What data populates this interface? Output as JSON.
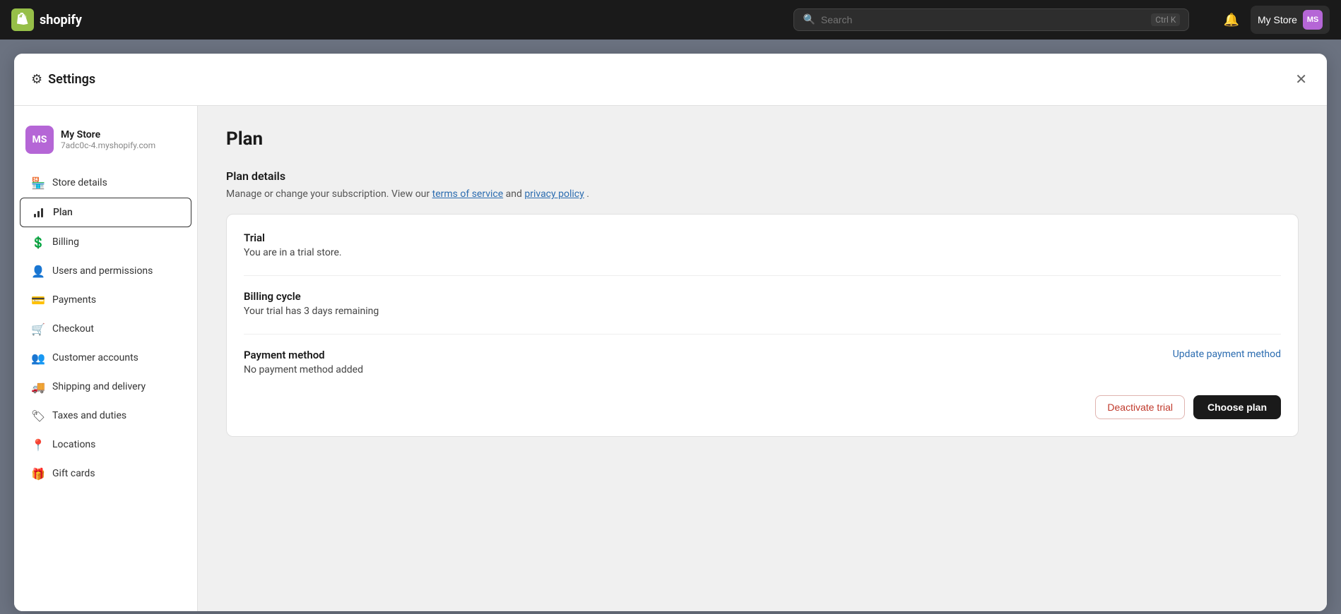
{
  "navbar": {
    "logo_text": "shopify",
    "logo_initials": "S",
    "search_placeholder": "Search",
    "search_shortcut": "Ctrl K",
    "store_name": "My Store",
    "store_initials": "MS",
    "bell_icon": "🔔"
  },
  "settings": {
    "title": "Settings",
    "close_icon": "✕",
    "gear_icon": "⚙"
  },
  "store_info": {
    "initials": "MS",
    "name": "My Store",
    "domain": "7adc0c-4.myshopify.com"
  },
  "sidebar": {
    "items": [
      {
        "id": "store-details",
        "label": "Store details",
        "icon": "🏪"
      },
      {
        "id": "plan",
        "label": "Plan",
        "icon": "📊",
        "active": true
      },
      {
        "id": "billing",
        "label": "Billing",
        "icon": "💲"
      },
      {
        "id": "users-and-permissions",
        "label": "Users and permissions",
        "icon": "👤"
      },
      {
        "id": "payments",
        "label": "Payments",
        "icon": "💳"
      },
      {
        "id": "checkout",
        "label": "Checkout",
        "icon": "🛒"
      },
      {
        "id": "customer-accounts",
        "label": "Customer accounts",
        "icon": "👥"
      },
      {
        "id": "shipping-and-delivery",
        "label": "Shipping and delivery",
        "icon": "🚚"
      },
      {
        "id": "taxes-and-duties",
        "label": "Taxes and duties",
        "icon": "🏷"
      },
      {
        "id": "locations",
        "label": "Locations",
        "icon": "📍"
      },
      {
        "id": "gift-cards",
        "label": "Gift cards",
        "icon": "🎁"
      }
    ]
  },
  "main": {
    "page_title": "Plan",
    "plan_details": {
      "section_title": "Plan details",
      "description_before": "Manage or change your subscription. View our",
      "tos_link": "terms of service",
      "description_middle": "and",
      "privacy_link": "privacy policy",
      "description_after": ".",
      "trial_label": "Trial",
      "trial_value": "You are in a trial store.",
      "billing_cycle_label": "Billing cycle",
      "billing_cycle_value": "Your trial has 3 days remaining",
      "payment_method_label": "Payment method",
      "payment_method_value": "No payment method added",
      "update_link": "Update payment method",
      "deactivate_btn": "Deactivate trial",
      "choose_btn": "Choose plan"
    }
  }
}
